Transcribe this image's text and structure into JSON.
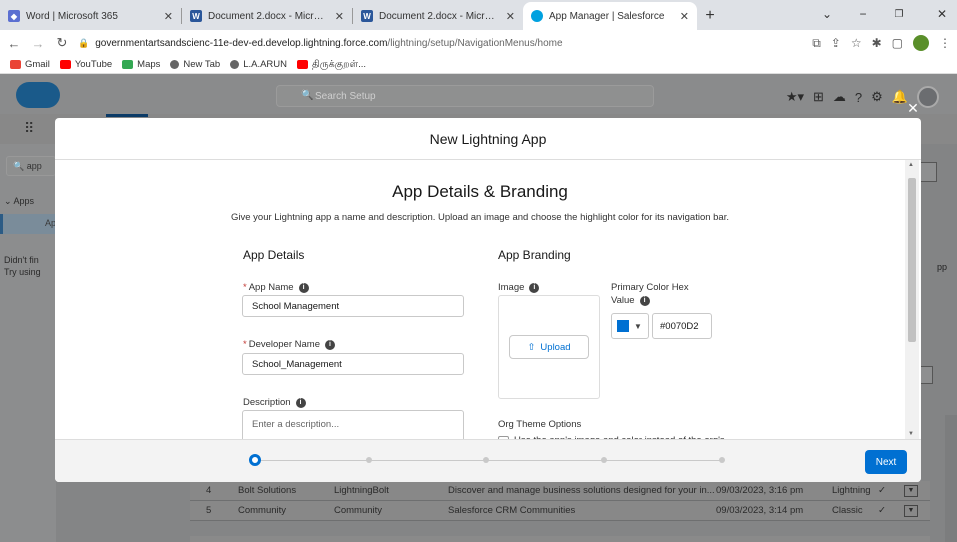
{
  "browser": {
    "tabs": [
      {
        "title": "Word | Microsoft 365",
        "favicon": "microsoft365-icon",
        "color": "#5b6fd1"
      },
      {
        "title": "Document 2.docx - Microsoft Wo",
        "favicon": "word-icon",
        "color": "#2b579a"
      },
      {
        "title": "Document 2.docx - Microsoft Wo",
        "favicon": "word-icon",
        "color": "#2b579a"
      },
      {
        "title": "App Manager | Salesforce",
        "favicon": "salesforce-icon",
        "color": "#00a1e0"
      }
    ],
    "url_host": "governmentartsandscienc-11e-dev-ed.develop.lightning.force.com",
    "url_path": "/lightning/setup/NavigationMenus/home",
    "bookmarks": [
      "Gmail",
      "YouTube",
      "Maps",
      "New Tab",
      "L.A.ARUN",
      "திருக்குறள்..."
    ]
  },
  "sf": {
    "search_placeholder": "Search Setup",
    "left_search": "app",
    "apps_label": "Apps",
    "apps_selected": "Ap",
    "didnt_find": "Didn't fin",
    "try_using": "Try using",
    "right_fragment": "pp"
  },
  "bg_rows": [
    {
      "num": "4",
      "label": "Bolt Solutions",
      "dev": "LightningBolt",
      "desc": "Discover and manage business solutions designed for your in...",
      "date": "09/03/2023, 3:16 pm",
      "type": "Lightning",
      "visible": "✓"
    },
    {
      "num": "5",
      "label": "Community",
      "dev": "Community",
      "desc": "Salesforce CRM Communities",
      "date": "09/03/2023, 3:14 pm",
      "type": "Classic",
      "visible": "✓"
    }
  ],
  "modal": {
    "header": "New Lightning App",
    "title": "App Details & Branding",
    "subtitle": "Give your Lightning app a name and description. Upload an image and choose the highlight color for its navigation bar.",
    "details": {
      "heading": "App Details",
      "app_name_label": "App Name",
      "app_name_value": "School Management",
      "dev_name_label": "Developer Name",
      "dev_name_value": "School_Management",
      "desc_label": "Description",
      "desc_placeholder": "Enter a description..."
    },
    "branding": {
      "heading": "App Branding",
      "image_label": "Image",
      "upload_label": "Upload",
      "color_label_1": "Primary Color Hex",
      "color_label_2": "Value",
      "color_value": "#0070D2",
      "org_theme_label": "Org Theme Options",
      "org_theme_checkbox": "Use the app's image and color instead of the org's"
    },
    "progress_step": 1,
    "next_label": "Next"
  }
}
